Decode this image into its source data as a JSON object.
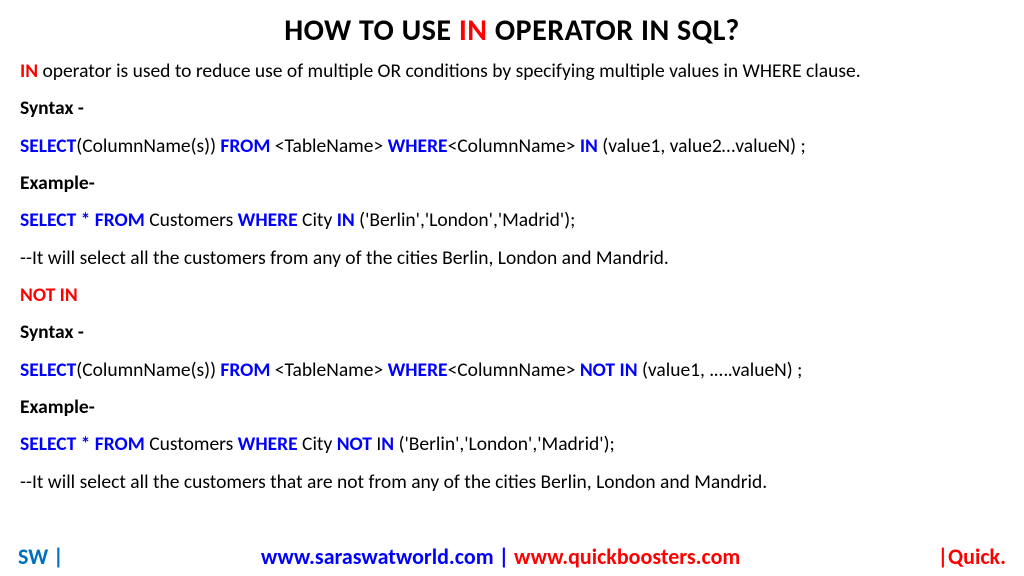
{
  "title": {
    "pre": "HOW TO USE ",
    "mid": "IN",
    "post": " OPERATOR IN SQL?"
  },
  "intro": {
    "lead": "IN",
    "rest": " operator is used to reduce use of multiple OR conditions by specifying multiple values in WHERE clause."
  },
  "labels": {
    "syntax": "Syntax -",
    "example": "Example-"
  },
  "syntax1": {
    "select": "SELECT",
    "cols": "(ColumnName(s)) ",
    "from": "FROM",
    "table": " <TableName> ",
    "where": "WHERE",
    "col": "<ColumnName> ",
    "in": "IN",
    "vals": " (value1, value2…valueN) ;"
  },
  "example1": {
    "select": "SELECT * FROM",
    "table": " Customers ",
    "where": "WHERE",
    "col": " City ",
    "in": "IN",
    "vals": " ('Berlin','London','Madrid');"
  },
  "comment1": "--It will select all the customers from any of the cities Berlin, London and Mandrid.",
  "notin": "NOT IN",
  "syntax2": {
    "select": "SELECT",
    "cols": "(ColumnName(s)) ",
    "from": "FROM",
    "table": " <TableName> ",
    "where": "WHERE",
    "col": "<ColumnName> ",
    "notin": "NOT IN",
    "vals": " (value1, .….valueN) ;"
  },
  "example2": {
    "select": "SELECT * FROM",
    "table": " Customers ",
    "where": "WHERE",
    "col": " City ",
    "not": "NOT",
    "i": " I",
    "n": "N",
    "vals": " ('Berlin','London','Madrid');"
  },
  "comment2": "--It will select all the customers that are not from any of the cities Berlin, London and Mandrid.",
  "footer": {
    "sw": "SW |",
    "url1": "www.saraswatworld.com",
    "sep": " | ",
    "url2": "www.quickboosters.com",
    "right": "|Quick."
  }
}
